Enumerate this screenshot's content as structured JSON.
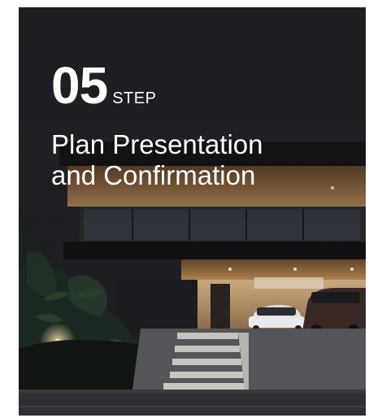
{
  "step": {
    "number": "05",
    "word": "STEP",
    "title_line1": "Plan Presentation",
    "title_line2": "and Confirmation"
  },
  "colors": {
    "text": "#ffffff",
    "night_sky": "#1f1f23",
    "interior_glow": "#c9a06a",
    "background": "#ffffff"
  },
  "image": {
    "subject": "modern-house-night-render"
  }
}
